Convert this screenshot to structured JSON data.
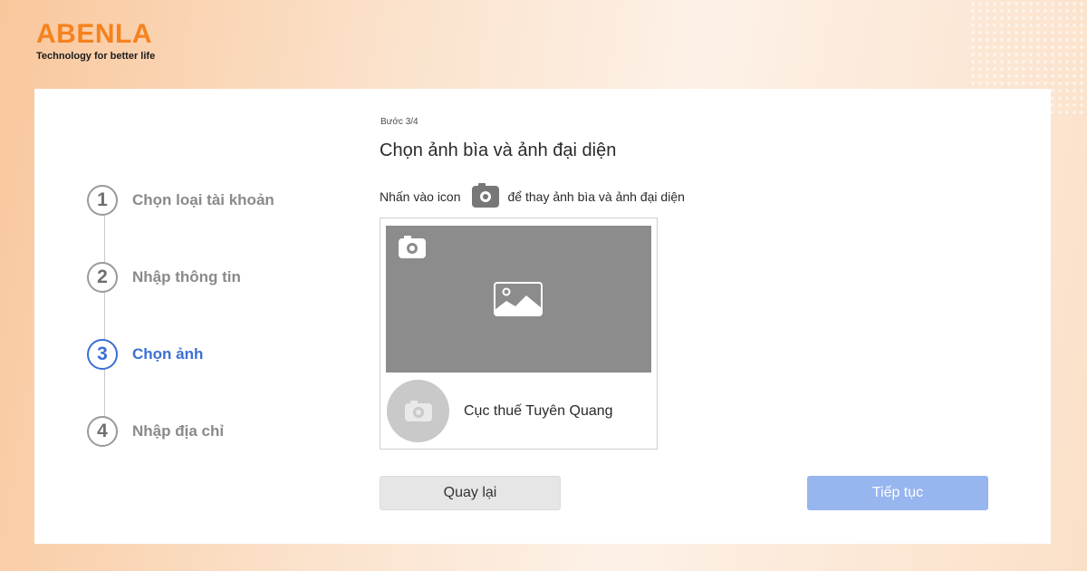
{
  "brand": {
    "name": "ABENLA",
    "tagline": "Technology for better life",
    "accent_color": "#f5821f"
  },
  "stepper": {
    "active_index": 2,
    "active_color": "#3b6fd6",
    "steps": [
      {
        "number": "1",
        "label": "Chọn loại tài khoản"
      },
      {
        "number": "2",
        "label": "Nhập thông tin"
      },
      {
        "number": "3",
        "label": "Chọn ảnh"
      },
      {
        "number": "4",
        "label": "Nhập địa chỉ"
      }
    ]
  },
  "form": {
    "step_count": "Bước 3/4",
    "title": "Chọn ảnh bìa và ảnh đại diện",
    "instruction_before": "Nhấn vào icon",
    "instruction_icon": "camera-icon",
    "instruction_after": "để thay ảnh bìa và ảnh đại diện",
    "cover_placeholder_icon": "image-icon",
    "profile_name": "Cục thuế Tuyên Quang"
  },
  "buttons": {
    "back_label": "Quay lại",
    "next_label": "Tiếp tục"
  }
}
